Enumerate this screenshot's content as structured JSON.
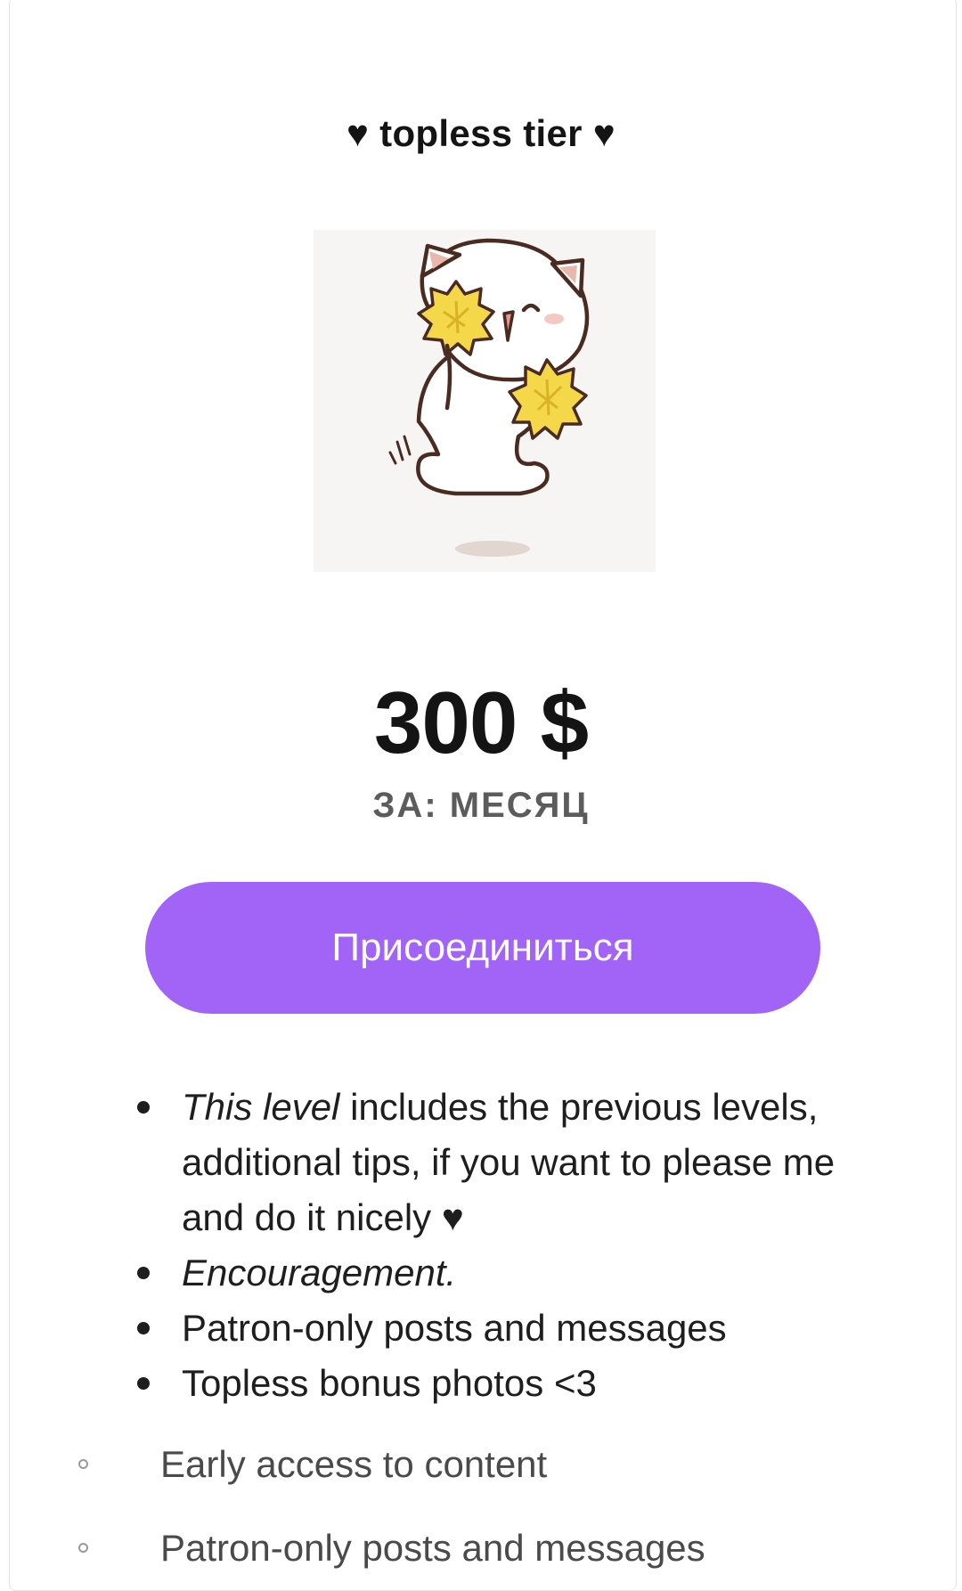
{
  "tier": {
    "title": "♥ topless tier ♥",
    "image_alt_icon": "cheerleader-cat-illustration",
    "price": "300 $",
    "period": "ЗА: МЕСЯЦ",
    "join_label": "Присоединиться"
  },
  "benefits": {
    "item1_italic": "This level",
    "item1_rest": " includes the previous levels, additional tips, if you want to please me and do it nicely ♥",
    "item2": "Encouragement.",
    "item3": "Patron-only posts and messages",
    "item4": "Topless bonus photos <3"
  },
  "sub_benefits": [
    "Early access to content",
    "Patron-only posts and messages"
  ],
  "colors": {
    "accent": "#a264f7",
    "text": "#1e1e1e",
    "muted": "#5c5c5c"
  }
}
